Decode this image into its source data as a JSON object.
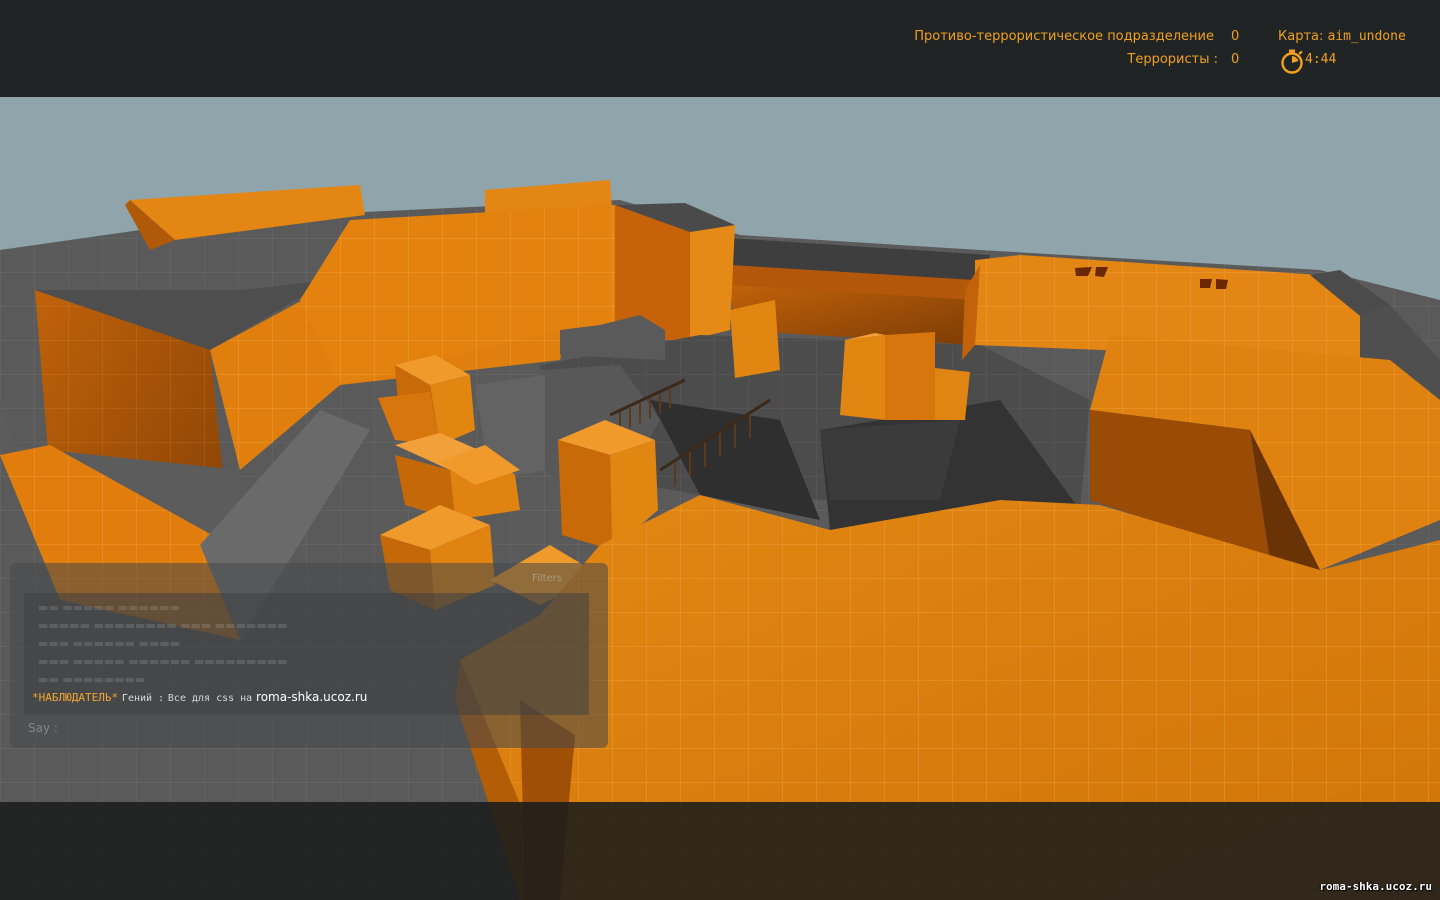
{
  "scoreboard": {
    "ct_team_label": "Противо-террористическое подразделение",
    "ct_score": "0",
    "t_team_label": "Террористы :",
    "t_score": "0"
  },
  "map": {
    "label": "Карта:",
    "name": "aim_undone"
  },
  "timer": {
    "icon": "stopwatch-icon",
    "time": "4:44"
  },
  "chat": {
    "filters_label": "Filters",
    "message": {
      "tag": "*НАБЛЮДАТЕЛЬ*",
      "author": "Гений :",
      "text": "Все для css на",
      "site": "roma-shka.ucoz.ru"
    },
    "say_label": "Say :"
  },
  "watermark": "roma-shka.ucoz.ru",
  "colors": {
    "hud_text": "#f0a020",
    "hud_bar": "#1a1c1d",
    "wall_orange": "#e5830c",
    "wall_grey": "#5f5f5f",
    "sky": "#8fa3aa"
  }
}
